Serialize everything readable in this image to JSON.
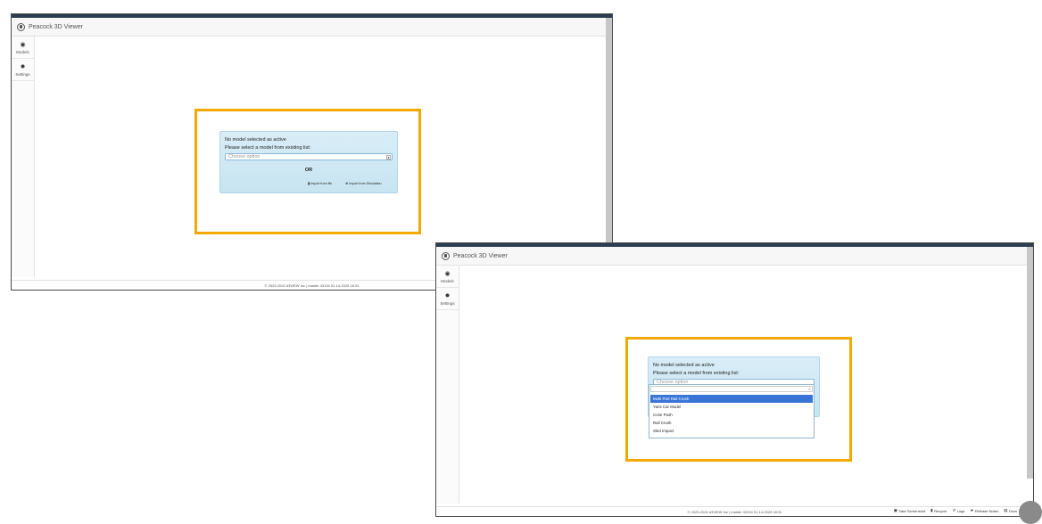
{
  "app": {
    "title": "Peacock 3D Viewer"
  },
  "sidebar": {
    "items": [
      {
        "label": "Models"
      },
      {
        "label": "Settings"
      }
    ]
  },
  "panel": {
    "no_model": "No model selected as active",
    "select_prompt": "Please select a model from existing list:",
    "placeholder": "Choose option",
    "or_text": "OR",
    "import_file": "Import from file",
    "import_simulation": "Import from Simulation"
  },
  "dropdown": {
    "options": [
      "Multi Part Rail Crush",
      "Yaris Car Model",
      "Cone Push",
      "Rail Crush",
      "Sled Impact"
    ],
    "selected_index": 0
  },
  "footer": {
    "copyright": "© 2023-2024 d3VIEW Inc | master 43134 01-14-2025 18:31",
    "actions": [
      "Take Screenshot",
      "Recycle",
      "Logs",
      "Release Notes",
      "Docs"
    ]
  },
  "colors": {
    "highlight": "#f5a800",
    "header": "#2c3e50",
    "panel": "#d9edf7",
    "selected": "#3875d7"
  }
}
